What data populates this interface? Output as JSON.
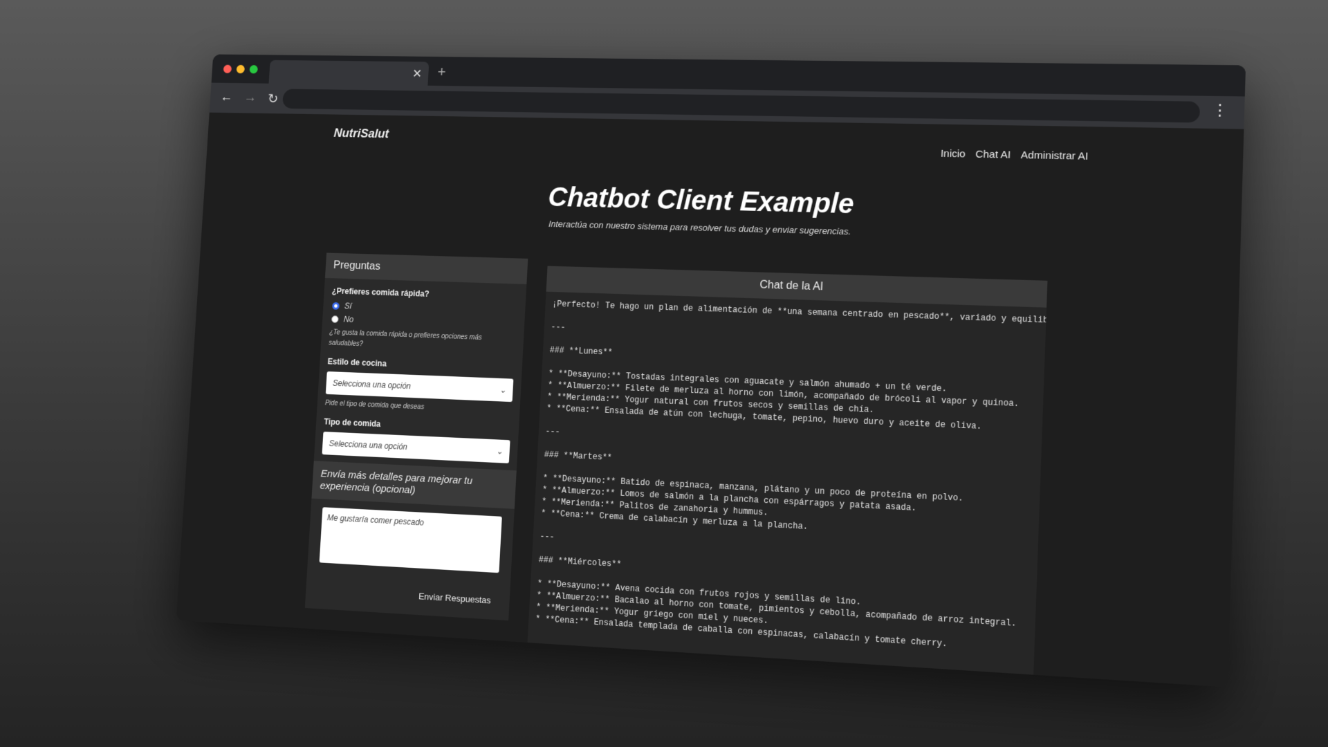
{
  "browser": {
    "tab_close_glyph": "✕",
    "new_tab_glyph": "+",
    "back_glyph": "←",
    "forward_glyph": "→",
    "reload_glyph": "↻",
    "menu_glyph": "⋮"
  },
  "site": {
    "brand": "NutriSalut",
    "nav": [
      "Inicio",
      "Chat AI",
      "Administrar AI"
    ]
  },
  "hero": {
    "title": "Chatbot Client Example",
    "subtitle": "Interactúa con nuestro sistema para resolver tus dudas y enviar sugerencias."
  },
  "questions": {
    "header": "Preguntas",
    "q1_label": "¿Prefieres comida rápida?",
    "q1_options": [
      {
        "label": "Sí",
        "checked": true
      },
      {
        "label": "No",
        "checked": false
      }
    ],
    "q1_help": "¿Te gusta la comida rápida o prefieres opciones más saludables?",
    "q2_label": "Estilo de cocina",
    "q2_value": "Selecciona una opción",
    "q2_help": "Pide el tipo de comida que deseas",
    "q3_label": "Tipo de comida",
    "q3_value": "Selecciona una opción",
    "extra_header": "Envía más detalles para mejorar tu experiencia (opcional)",
    "textarea_value": "Me gustaría comer pescado",
    "submit_label": "Enviar Respuestas"
  },
  "chat": {
    "header": "Chat de la AI",
    "lines": [
      "¡Perfecto! Te hago un plan de alimentación de **una semana centrado en pescado**, variado y equilibr",
      "",
      "---",
      "",
      "### **Lunes**",
      "",
      "* **Desayuno:** Tostadas integrales con aguacate y salmón ahumado + un té verde.",
      "* **Almuerzo:** Filete de merluza al horno con limón, acompañado de brócoli al vapor y quinoa.",
      "* **Merienda:** Yogur natural con frutos secos y semillas de chía.",
      "* **Cena:** Ensalada de atún con lechuga, tomate, pepino, huevo duro y aceite de oliva.",
      "",
      "---",
      "",
      "### **Martes**",
      "",
      "* **Desayuno:** Batido de espinaca, manzana, plátano y un poco de proteína en polvo.",
      "* **Almuerzo:** Lomos de salmón a la plancha con espárragos y patata asada.",
      "* **Merienda:** Palitos de zanahoria y hummus.",
      "* **Cena:** Crema de calabacín y merluza a la plancha.",
      "",
      "---",
      "",
      "### **Miércoles**",
      "",
      "* **Desayuno:** Avena cocida con frutos rojos y semillas de lino.",
      "* **Almuerzo:** Bacalao al horno con tomate, pimientos y cebolla, acompañado de arroz integral.",
      "* **Merienda:** Yogur griego con miel y nueces.",
      "* **Cena:** Ensalada templada de caballa con espinacas, calabacín y tomate cherry."
    ]
  }
}
